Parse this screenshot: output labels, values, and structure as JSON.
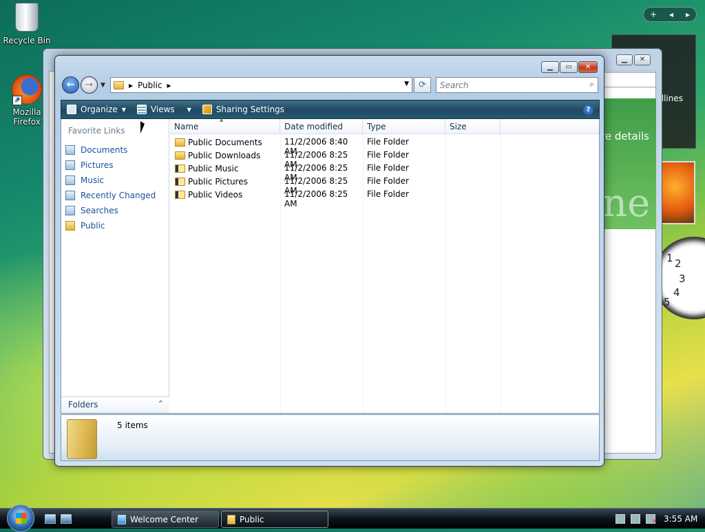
{
  "desktop": {
    "icons": [
      {
        "label": "Recycle Bin"
      },
      {
        "label": "Mozilla Firefox"
      }
    ]
  },
  "background_window": {
    "partial_text_1": "dlines",
    "partial_text_2": "re details",
    "partial_text_3": "ne"
  },
  "window": {
    "address": {
      "crumb": "Public"
    },
    "search": {
      "placeholder": "Search"
    },
    "toolbar": {
      "organize": "Organize",
      "views": "Views",
      "sharing": "Sharing Settings"
    },
    "nav_pane": {
      "favorite_links_title": "Favorite Links",
      "links": [
        {
          "label": "Documents"
        },
        {
          "label": "Pictures"
        },
        {
          "label": "Music"
        },
        {
          "label": "Recently Changed"
        },
        {
          "label": "Searches"
        },
        {
          "label": "Public"
        }
      ],
      "folders_label": "Folders"
    },
    "columns": {
      "name": "Name",
      "date": "Date modified",
      "type": "Type",
      "size": "Size"
    },
    "files": [
      {
        "name": "Public Documents",
        "date": "11/2/2006 8:40 AM",
        "type": "File Folder"
      },
      {
        "name": "Public Downloads",
        "date": "11/2/2006 8:25 AM",
        "type": "File Folder"
      },
      {
        "name": "Public Music",
        "date": "11/2/2006 8:25 AM",
        "type": "File Folder"
      },
      {
        "name": "Public Pictures",
        "date": "11/2/2006 8:25 AM",
        "type": "File Folder"
      },
      {
        "name": "Public Videos",
        "date": "11/2/2006 8:25 AM",
        "type": "File Folder"
      }
    ],
    "details": {
      "item_count": "5 items"
    }
  },
  "taskbar": {
    "tasks": [
      {
        "label": "Welcome Center"
      },
      {
        "label": "Public"
      }
    ],
    "clock": "3:55 AM"
  },
  "gadgets": {
    "clock_numbers": [
      "1",
      "2",
      "3",
      "4",
      "5"
    ]
  }
}
